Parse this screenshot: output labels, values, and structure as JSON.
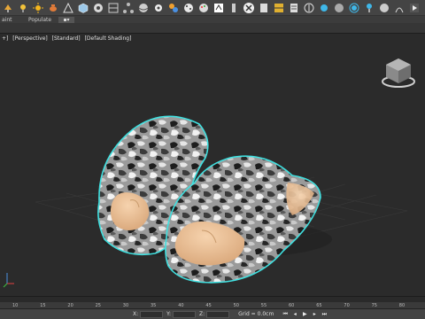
{
  "ribbon": {
    "paint_label": "aint",
    "populate_label": "Populate",
    "dropdown_icon": "cube-dropdown"
  },
  "viewport": {
    "label_plus": "+]",
    "label_view": "[Perspective]",
    "label_mode": "[Standard]",
    "label_shading": "[Default Shading]"
  },
  "timeline": {
    "ticks": [
      "10",
      "15",
      "20",
      "25",
      "30",
      "35",
      "40",
      "45",
      "50",
      "55",
      "60",
      "65",
      "70",
      "75",
      "80"
    ]
  },
  "status": {
    "x_label": "X:",
    "y_label": "Y:",
    "z_label": "Z:",
    "grid_text": "Grid = 0.0cm"
  },
  "colors": {
    "accent": "#3fb7e8",
    "selection_outline": "#40e0e0",
    "background": "#2b2b2b"
  },
  "icons": [
    "lamp-icon",
    "light-icon",
    "sun-icon",
    "teapot-icon",
    "shape-icon",
    "cube-icon",
    "render-icon",
    "material-icon",
    "network-icon",
    "sphere-icon",
    "gear-icon",
    "blob-icon",
    "sphere-small-icon",
    "palette-icon",
    "folder-icon",
    "brush-icon",
    "render-logo-icon",
    "doc-icon",
    "grid-icon",
    "cog-icon",
    "circle-icon",
    "blob2-icon",
    "render2-icon",
    "light2-icon",
    "bulb-icon",
    "render3-icon",
    "hair-icon",
    "play-icon"
  ]
}
